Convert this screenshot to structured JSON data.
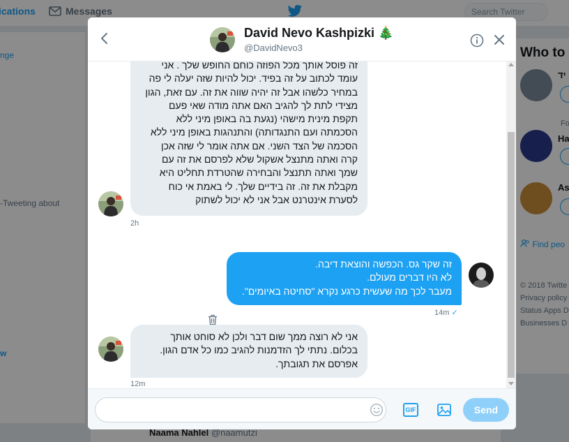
{
  "background": {
    "nav_notifications": "ications",
    "nav_messages": "Messages",
    "search_placeholder": "Search Twitter",
    "left_fragments": [
      "nge",
      "-Tweeting about",
      "w"
    ],
    "who_to_follow": "Who to f",
    "suggestions": [
      {
        "label": "יד"
      },
      {
        "label": "Ha",
        "context": "Fo"
      },
      {
        "label": "As"
      }
    ],
    "find_people": "Find peo",
    "footer": {
      "copyright": "© 2018 Twitte",
      "privacy": "Privacy policy",
      "status_apps": "Status  Apps  D",
      "businesses": "Businesses  D"
    },
    "bottom_name": "Naama Nahlel",
    "bottom_handle": "@naamutzi"
  },
  "header": {
    "name": "David Nevo Kashpizki 🎄",
    "handle": "@DavidNevo3"
  },
  "messages": [
    {
      "direction": "received",
      "text": "זה פוסל אותך מכל הפוזה כוחם החופש שלך . אני\nעומד לכתוב על זה בפיד. יכול להיות שזה יעלה לי פה\nבמחיר כלשהו אבל זה יהיה שווה את זה. עם זאת, הגון\nמצידי לתת לך להגיב האם אתה מודה שאי פעם\nתקפת מינית מישהי (נגעת בה באופן מיני ללא\nהסכמתה ועם התנגדותה) והתנהגות באופן מיני ללא\nהסכמה של הצד השני. אם אתה אומר לי שזה אכן\nקרה ואתה מתנצל אשקול שלא לפרסם את זה עם\nשמך ואתה תתנצל והבחירה שהטרדת תחליט היא\nמקבלת את זה. זה בידיים שלך. לי באמת אי כוח\nלסערת אינטרנט אבל אני לא יכול לשתוק",
      "time": "2h"
    },
    {
      "direction": "sent",
      "text": "זה שקר גס. הכפשה והוצאת דיבה.\nלא היו דברים מעולם.\nמעבר לכך מה שעשית כרגע נקרא \"סחיטה באיומים\".",
      "time": "14m",
      "status": "✓"
    },
    {
      "direction": "received",
      "text": "אני לא רוצה ממך שום דבר ולכן לא סוחט אותך\nבכלום. נתתי לך הזדמנות להגיב כמו כל אדם הגון.\nאפרסם את תגובתך.",
      "time": "12m"
    }
  ],
  "composer": {
    "input_value": "",
    "gif_label": "GIF",
    "send_label": "Send"
  },
  "colors": {
    "accent": "#1da1f2",
    "bubble_received": "#e6ecf0",
    "send_disabled": "#8ed0f9"
  }
}
